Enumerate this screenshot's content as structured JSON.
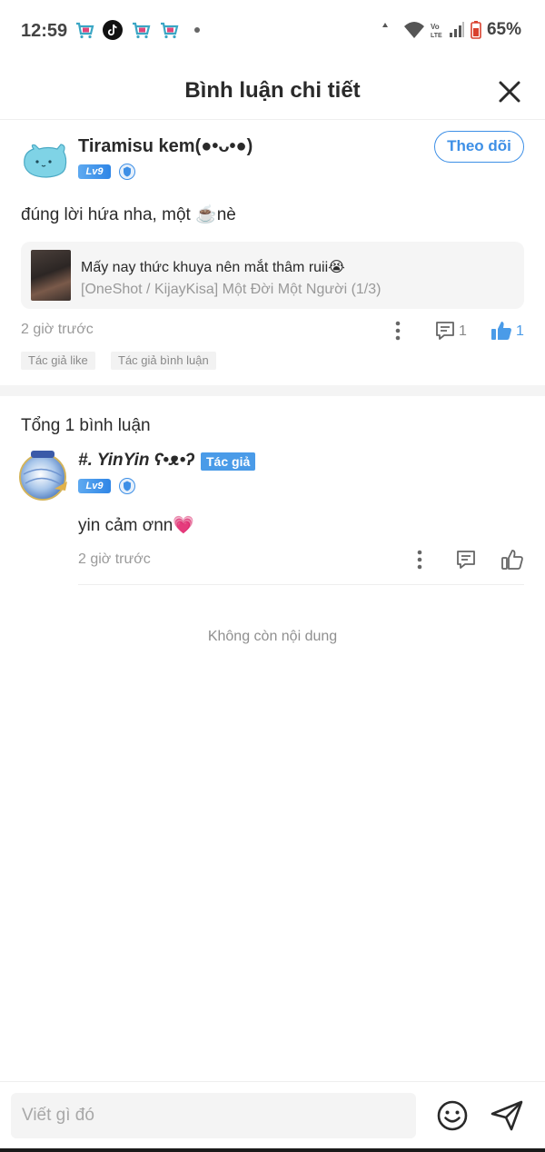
{
  "status_bar": {
    "time": "12:59",
    "battery": "65%",
    "app_icons": [
      "shopping-cart-icon",
      "tiktok-icon",
      "shopping-cart-icon",
      "shopping-cart-icon"
    ],
    "network_label": "Vo LTE"
  },
  "header": {
    "title": "Bình luận chi tiết",
    "close_icon": "close-icon"
  },
  "main_comment": {
    "username": "Tiramisu kem(●•ᴗ•●)",
    "level": "Lv9",
    "follow_label": "Theo dõi",
    "text": "đúng lời hứa nha, một ☕️nè",
    "reference": {
      "title": "Mấy nay thức khuya nên mắt thâm ruii😭",
      "subtitle": "[OneShot / KijayKisa] Một Đời Một Người (1/3)"
    },
    "time": "2 giờ trước",
    "reply_count": "1",
    "like_count": "1",
    "tags": [
      "Tác giả like",
      "Tác giả bình luận"
    ]
  },
  "replies": {
    "total_label": "Tổng 1 bình luận",
    "items": [
      {
        "username": "#. YinYin ʕ•ᴥ•ʔ",
        "author_tag": "Tác giả",
        "level": "Lv9",
        "text": "yin cảm ơnn💗",
        "time": "2 giờ trước"
      }
    ],
    "end_label": "Không còn nội dung"
  },
  "input_bar": {
    "placeholder": "Viết gì đó"
  },
  "colors": {
    "accent": "#3d8fe6",
    "like_blue": "#4a9be8",
    "muted_text": "#9a9a9a"
  }
}
